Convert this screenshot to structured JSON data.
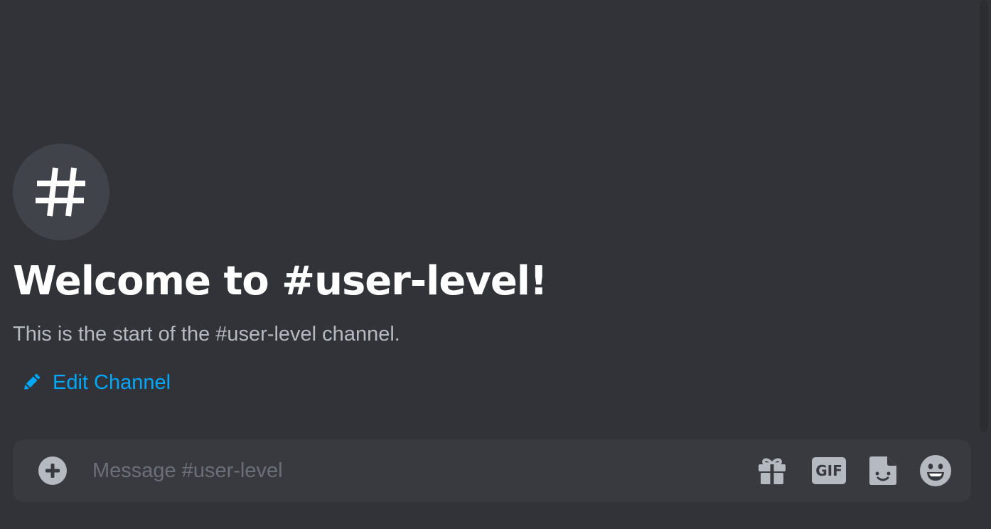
{
  "channel": {
    "name": "user-level",
    "avatar_glyph": "#"
  },
  "welcome": {
    "title": "Welcome to #user-level!",
    "description": "This is the start of the #user-level channel."
  },
  "actions": {
    "edit_channel_label": "Edit Channel",
    "edit_icon": "pencil-icon"
  },
  "composer": {
    "placeholder": "Message #user-level",
    "value": "",
    "attach_icon": "plus-circle-icon",
    "tools": {
      "gift_icon": "gift-icon",
      "gif_label": "GIF",
      "sticker_icon": "sticker-icon",
      "emoji_icon": "emoji-icon"
    }
  },
  "colors": {
    "background": "#313338",
    "composer": "#383a40",
    "avatar_bg": "#41434a",
    "link": "#00a8fc",
    "title": "#ffffff",
    "muted_text": "#b5bac1",
    "placeholder": "#6d6f78",
    "icon": "#b5bac1"
  }
}
